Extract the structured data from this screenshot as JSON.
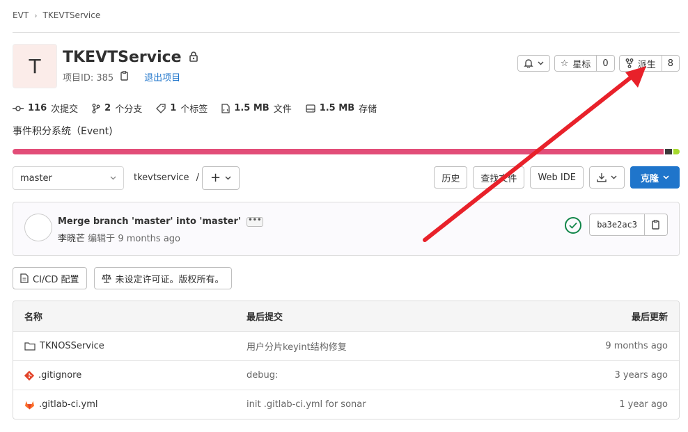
{
  "breadcrumb": {
    "group": "EVT",
    "project": "TKEVTService"
  },
  "project": {
    "avatar_letter": "T",
    "name": "TKEVTService",
    "id_label": "项目ID: 385",
    "leave_label": "退出项目",
    "description": "事件积分系统（Event)"
  },
  "actions": {
    "star_label": "星标",
    "star_count": "0",
    "fork_label": "派生",
    "fork_count": "8"
  },
  "stats": {
    "commits_count": "116",
    "commits_label": "次提交",
    "branches_count": "2",
    "branches_label": "个分支",
    "tags_count": "1",
    "tags_label": "个标签",
    "files_size": "1.5 MB",
    "files_label": "文件",
    "storage_size": "1.5 MB",
    "storage_label": "存储"
  },
  "repo": {
    "branch": "master",
    "path": "tkevtservice",
    "path_sep": "/",
    "history_label": "历史",
    "find_file_label": "查找文件",
    "web_ide_label": "Web IDE",
    "clone_label": "克隆"
  },
  "commit": {
    "title": "Merge branch 'master' into 'master'",
    "ellipsis": "•••",
    "author": "李晓芒",
    "action": "编辑于",
    "time": "9 months ago",
    "sha": "ba3e2ac3"
  },
  "license": {
    "cicd_label": "CI/CD 配置",
    "license_label": "未设定许可证。版权所有。"
  },
  "table": {
    "headers": {
      "name": "名称",
      "last_commit": "最后提交",
      "last_update": "最后更新"
    },
    "rows": [
      {
        "name": "TKNOSService",
        "commit": "用户分片keyint结构修复",
        "updated": "9 months ago"
      },
      {
        "name": ".gitignore",
        "commit": "debug:",
        "updated": "3 years ago"
      },
      {
        "name": ".gitlab-ci.yml",
        "commit": "init .gitlab-ci.yml for sonar",
        "updated": "1 year ago"
      }
    ]
  },
  "colors": {
    "primary": "#1f75cb",
    "annotation_arrow": "#e8212a",
    "language_main": "#e24d78",
    "pipeline_success": "#108548"
  }
}
